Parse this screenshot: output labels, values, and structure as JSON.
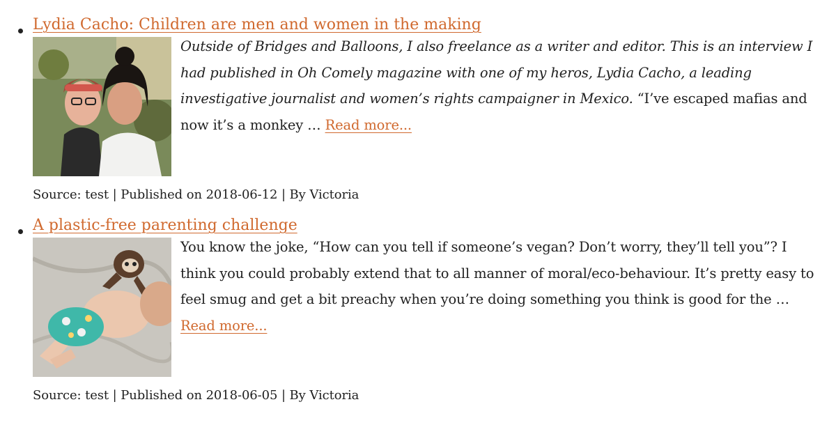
{
  "posts": [
    {
      "title": "Lydia Cacho: Children are men and women in the making",
      "thumbnail": "two-women-portrait",
      "excerpt_italic": "Outside of Bridges and Balloons, I also freelance as a writer and editor. This is an interview I had published in Oh Comely magazine with one of my heros, Lydia Cacho, a leading investigative journalist and women’s rights campaigner in Mexico.",
      "excerpt_regular": "  “I’ve escaped mafias and now it’s a monkey … ",
      "read_more": "Read more...",
      "meta": "Source: test | Published on 2018-06-12 | By Victoria"
    },
    {
      "title": "A plastic-free parenting challenge",
      "thumbnail": "baby-cloth-nappy-sloth",
      "excerpt_regular": "You know the joke, “How can you tell if someone’s vegan? Don’t worry, they’ll tell you”? I think you could probably extend that to all manner of moral/eco-behaviour. It’s pretty easy to feel smug and get a bit preachy when you’re doing something you think is good for the … ",
      "read_more": "Read more...",
      "meta": "Source: test | Published on 2018-06-05 | By Victoria"
    }
  ],
  "colors": {
    "link": "#d0692e",
    "text": "#1f1f1f",
    "background": "#ffffff"
  }
}
